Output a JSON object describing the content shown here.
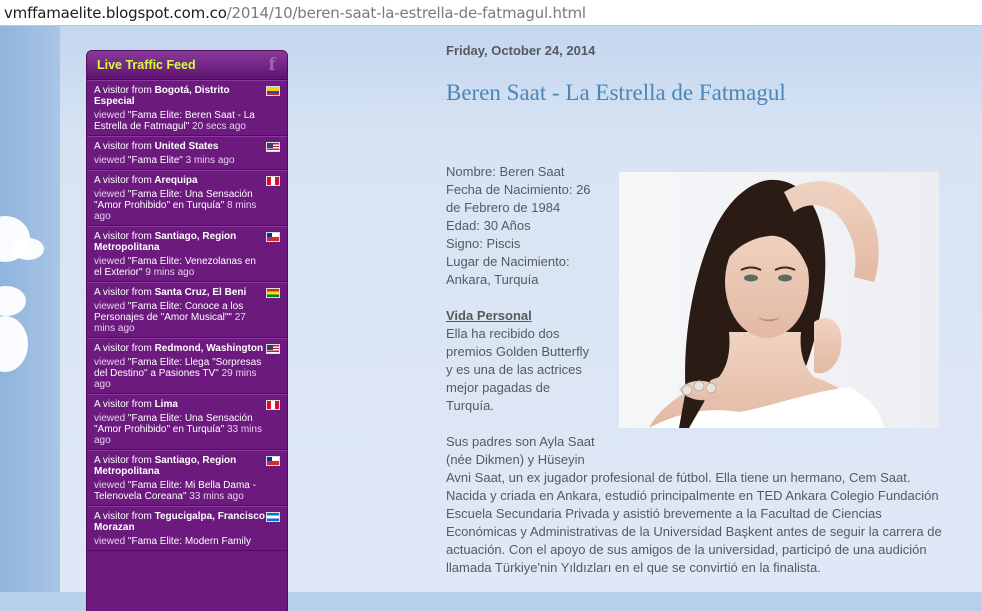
{
  "browser": {
    "url_host": "vmffamaelite.blogspot.com.co",
    "url_path": "/2014/10/beren-saat-la-estrella-de-fatmagul.html"
  },
  "feed": {
    "title": "Live Traffic Feed",
    "icon": "facebook-icon",
    "items": [
      {
        "prefix": "A visitor from",
        "location": "Bogotá, Distrito Especial",
        "viewed": "viewed",
        "page": "\"Fama Elite: Beren Saat - La Estrella de Fatmagul\"",
        "time": "20 secs ago",
        "flag": "colombia"
      },
      {
        "prefix": "A visitor from",
        "location": "United States",
        "viewed": "viewed",
        "page": "\"Fama Elite\"",
        "time": "3 mins ago",
        "flag": "united-states"
      },
      {
        "prefix": "A visitor from",
        "location": "Arequipa",
        "viewed": "viewed",
        "page": "\"Fama Elite: Una Sensación \"Amor Prohibido\" en Turquía\"",
        "time": "8 mins ago",
        "flag": "peru"
      },
      {
        "prefix": "A visitor from",
        "location": "Santiago, Region Metropolitana",
        "viewed": "viewed",
        "page": "\"Fama Elite: Venezolanas en el Exterior\"",
        "time": "9 mins ago",
        "flag": "chile"
      },
      {
        "prefix": "A visitor from",
        "location": "Santa Cruz, El Beni",
        "viewed": "viewed",
        "page": "\"Fama Elite: Conoce a los Personajes de \"Amor Musical\"\"",
        "time": "27 mins ago",
        "flag": "bolivia"
      },
      {
        "prefix": "A visitor from",
        "location": "Redmond, Washington",
        "viewed": "viewed",
        "page": "\"Fama Elite: Llega \"Sorpresas del Destino\" a Pasiones TV\"",
        "time": "29 mins ago",
        "flag": "united-states"
      },
      {
        "prefix": "A visitor from",
        "location": "Lima",
        "viewed": "viewed",
        "page": "\"Fama Elite: Una Sensación \"Amor Prohibido\" en Turquía\"",
        "time": "33 mins ago",
        "flag": "peru"
      },
      {
        "prefix": "A visitor from",
        "location": "Santiago, Region Metropolitana",
        "viewed": "viewed",
        "page": "\"Fama Elite: Mi Bella Dama - Telenovela Coreana\"",
        "time": "33 mins ago",
        "flag": "chile"
      },
      {
        "prefix": "A visitor from",
        "location": "Tegucigalpa, Francisco Morazan",
        "viewed": "viewed",
        "page": "\"Fama Elite: Modern Family",
        "time": "",
        "flag": "honduras"
      }
    ]
  },
  "post": {
    "date": "Friday, October 24, 2014",
    "title": "Beren Saat - La Estrella de Fatmagul",
    "info_lines": [
      "Nombre: Beren Saat",
      "Fecha de Nacimiento: 26",
      "de Febrero de 1984",
      "Edad: 30 Años",
      "Signo: Piscis",
      "Lugar de Nacimiento:",
      "Ankara, Turquía"
    ],
    "section_heading": "Vida Personal",
    "section_lines": [
      "Ella ha recibido dos",
      "premios Golden Butterfly",
      "y es una de las actrices",
      "mejor pagadas de",
      "Turquía."
    ],
    "para_lines": [
      "Sus padres son Ayla Saat",
      "(née Dikmen) y Hüseyin",
      "Avni Saat, un ex jugador profesional de fútbol. Ella tiene un hermano, Cem Saat.",
      "Nacida y criada en Ankara, estudió principalmente en TED Ankara Colegio Fundación",
      "Escuela Secundaria Privada y asistió brevemente a la Facultad de Ciencias",
      "Económicas y Administrativas de la Universidad Başkent antes de seguir la carrera de",
      "actuación. Con el apoyo de sus amigos de la universidad, participó de una audición",
      "llamada Türkiye'nin Yıldızları en el que se convirtió en la finalista."
    ]
  }
}
